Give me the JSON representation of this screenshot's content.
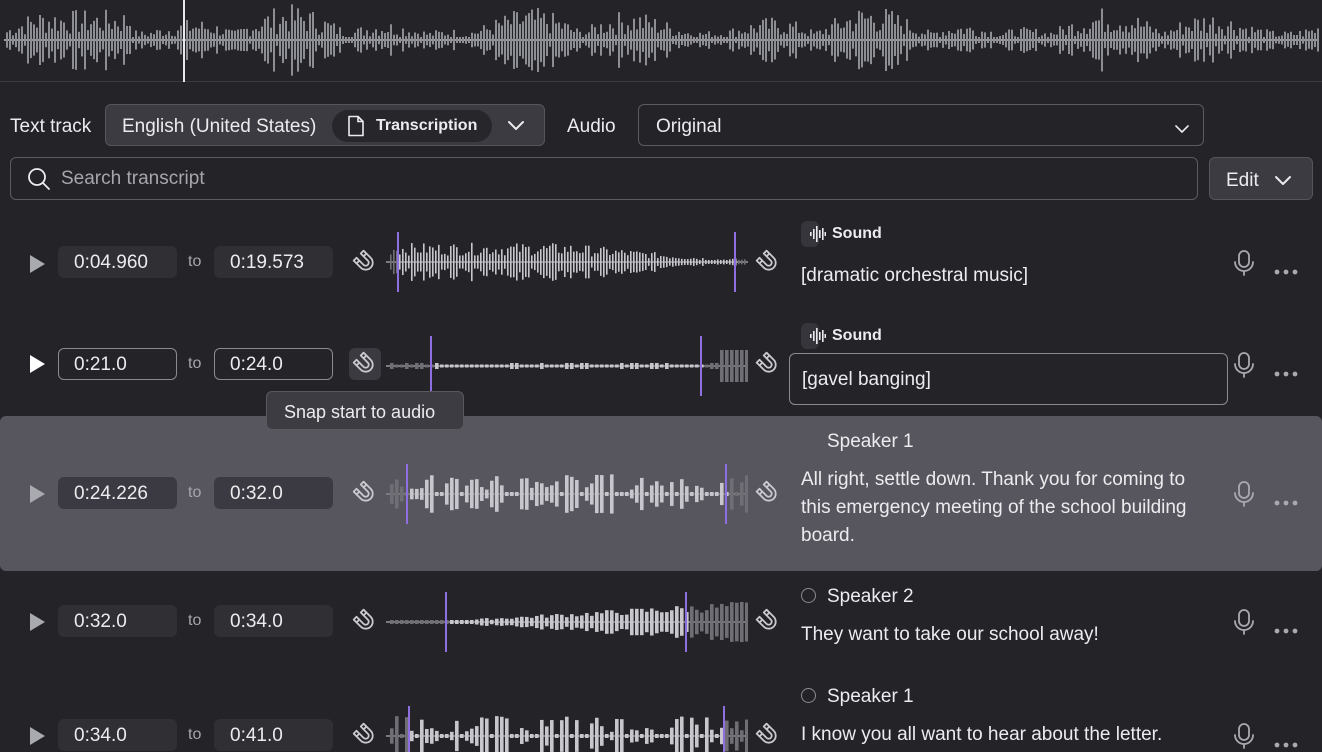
{
  "text_track": {
    "label": "Text track",
    "language": "English (United States)",
    "type_pill": "Transcription"
  },
  "audio": {
    "label": "Audio",
    "value": "Original"
  },
  "search": {
    "placeholder": "Search transcript"
  },
  "edit_button": {
    "label": "Edit"
  },
  "tooltip": {
    "text": "Snap start to audio"
  },
  "rows": [
    {
      "start": "0:04.960",
      "end": "0:19.573",
      "to": "to",
      "tag": "Sound",
      "text": "[dramatic orchestral music]"
    },
    {
      "start": "0:21.0",
      "end": "0:24.0",
      "to": "to",
      "tag": "Sound",
      "text": "[gavel banging]"
    },
    {
      "start": "0:24.226",
      "end": "0:32.0",
      "to": "to",
      "speaker": "Speaker 1",
      "text": "All right, settle down. Thank you for coming to this emergency meeting of the school building board."
    },
    {
      "start": "0:32.0",
      "end": "0:34.0",
      "to": "to",
      "speaker": "Speaker 2",
      "text": "They want to take our school away!"
    },
    {
      "start": "0:34.0",
      "end": "0:41.0",
      "to": "to",
      "speaker": "Speaker 1",
      "text": "I know you all want to hear about the letter."
    }
  ],
  "colors": {
    "accent_marker": "#8e6fe0",
    "active_row": "#57565f",
    "background": "#232328"
  }
}
